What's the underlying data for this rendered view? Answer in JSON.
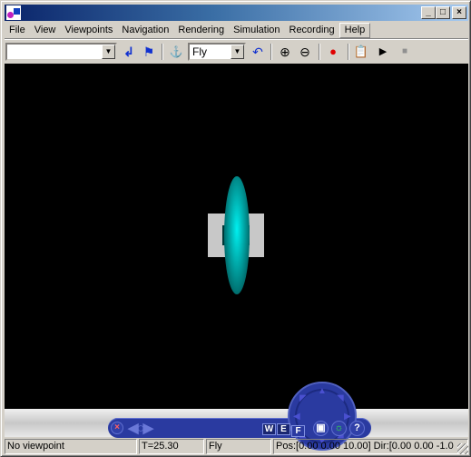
{
  "window": {
    "title": "",
    "controls": {
      "minimize": "_",
      "maximize": "□",
      "close": "×"
    }
  },
  "menubar": {
    "items": [
      {
        "label": "File"
      },
      {
        "label": "View"
      },
      {
        "label": "Viewpoints"
      },
      {
        "label": "Navigation"
      },
      {
        "label": "Rendering"
      },
      {
        "label": "Simulation"
      },
      {
        "label": "Recording"
      },
      {
        "label": "Help",
        "active": true
      }
    ]
  },
  "toolbar": {
    "viewpoint_combo": {
      "value": ""
    },
    "nav_mode_combo": {
      "value": "Fly"
    },
    "icons": {
      "return": "↲",
      "flag": "⚑",
      "straighten": "⚓",
      "undo": "↶",
      "zoom_in": "⊕",
      "zoom_out": "⊖",
      "record": "●",
      "clipboard": "📋",
      "play": "▶",
      "stop": "■"
    }
  },
  "viewport": {
    "background": "#000000",
    "ellipsoid_color": "#00e0e0",
    "box_color": "#c8c8c8"
  },
  "dashboard": {
    "close": "×",
    "wef": [
      "W",
      "E",
      "F"
    ],
    "fit": "▣",
    "light": "☼",
    "help": "?",
    "light_color": "#30ff30"
  },
  "statusbar": {
    "viewpoint": "No viewpoint",
    "time": "T=25.30",
    "mode": "Fly",
    "posdir": "Pos:[0.00 0.00 10.00] Dir:[0.00 0.00 -1.0"
  }
}
